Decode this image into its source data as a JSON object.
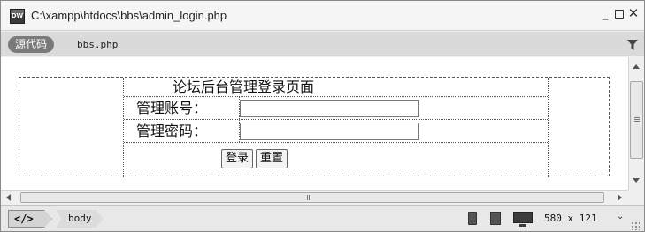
{
  "window": {
    "title": "C:\\xampp\\htdocs\\bbs\\admin_login.php",
    "app_icon_text": "DW",
    "minimize_glyph": "_",
    "close_glyph": "✕"
  },
  "toolbar": {
    "source_code_label": "源代码",
    "file_tab_label": "bbs.php",
    "filter_icon": "filter-icon"
  },
  "form": {
    "heading": "论坛后台管理登录页面",
    "username_label": "管理账号：",
    "username_value": "",
    "password_label": "管理密码：",
    "password_value": "",
    "login_button": "登录",
    "reset_button": "重置"
  },
  "hscroll": {
    "grip_glyph": "III"
  },
  "statusbar": {
    "code_tag": "</>",
    "tag_body": "body",
    "window_size": "580 x 121",
    "size_dropdown_arrow": "⌄"
  },
  "colors": {
    "titlebar_bg": "#f5f5f5",
    "tabbar_bg": "#dadada",
    "source_pill_bg": "#7a7a7a",
    "statusbar_bg": "#e8e8e8"
  }
}
